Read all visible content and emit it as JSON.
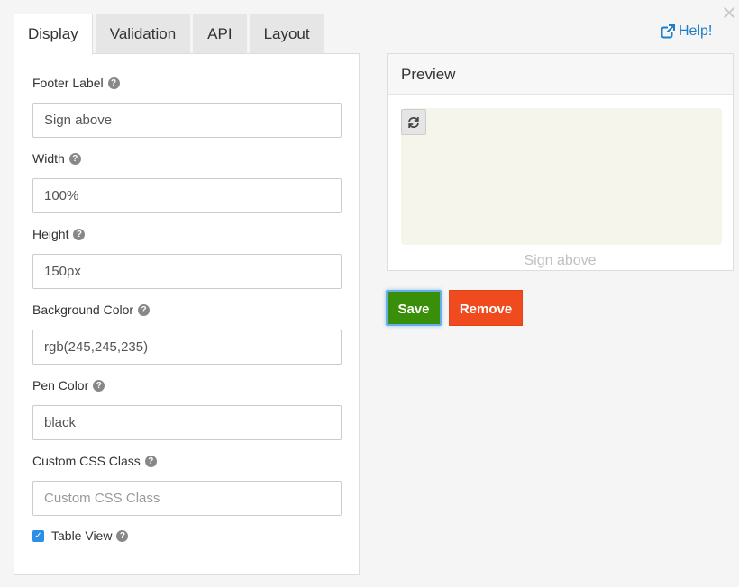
{
  "tabs": [
    {
      "label": "Display",
      "active": true
    },
    {
      "label": "Validation",
      "active": false
    },
    {
      "label": "API",
      "active": false
    },
    {
      "label": "Layout",
      "active": false
    }
  ],
  "fields": {
    "footer_label": {
      "label": "Footer Label",
      "value": "Sign above",
      "placeholder": ""
    },
    "width": {
      "label": "Width",
      "value": "100%",
      "placeholder": ""
    },
    "height": {
      "label": "Height",
      "value": "150px",
      "placeholder": ""
    },
    "background_color": {
      "label": "Background Color",
      "value": "rgb(245,245,235)",
      "placeholder": ""
    },
    "pen_color": {
      "label": "Pen Color",
      "value": "black",
      "placeholder": ""
    },
    "custom_css_class": {
      "label": "Custom CSS Class",
      "value": "",
      "placeholder": "Custom CSS Class"
    }
  },
  "table_view": {
    "label": "Table View",
    "checked": true
  },
  "help_link": {
    "label": "Help!"
  },
  "preview": {
    "title": "Preview",
    "footer": "Sign above",
    "pad_background": "#f5f5eb"
  },
  "buttons": {
    "save": "Save",
    "remove": "Remove"
  },
  "colors": {
    "save": "#3a8f0a",
    "remove": "#f04b1f",
    "link": "#1f7fc6",
    "checkbox": "#2d8ee6"
  },
  "icons": {
    "close": "close-icon",
    "help": "question-circle-icon",
    "external_link": "external-link-icon",
    "refresh": "refresh-icon",
    "checkbox": "checkbox-checked-icon"
  }
}
